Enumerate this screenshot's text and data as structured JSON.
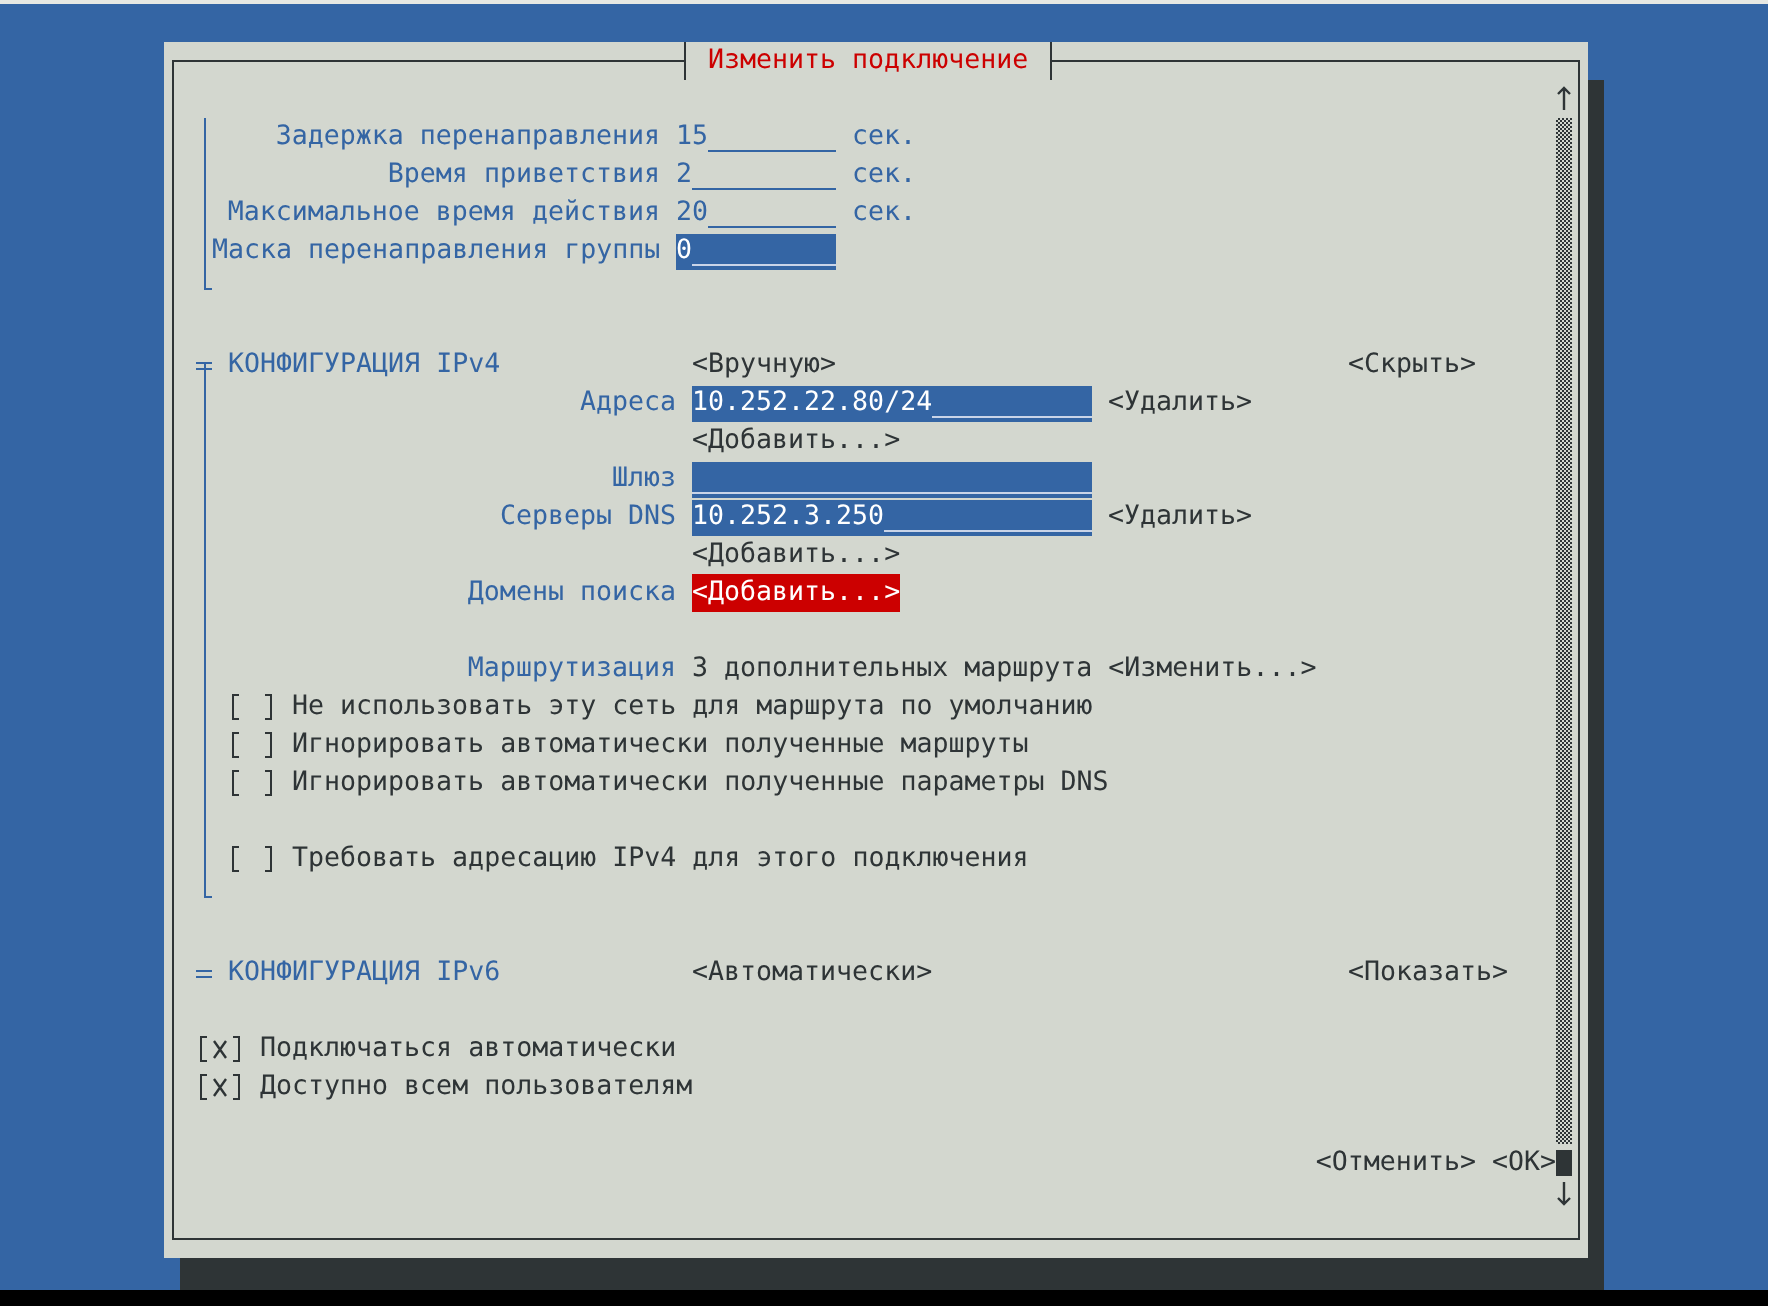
{
  "dialog": {
    "title": "Изменить подключение"
  },
  "bridge_settings": [
    {
      "label": "Задержка перенаправления",
      "value": "15",
      "unit": "сек.",
      "disabled": true
    },
    {
      "label": "Время приветствия",
      "value": "2",
      "unit": "сек.",
      "disabled": true
    },
    {
      "label": "Максимальное время действия",
      "value": "20",
      "unit": "сек.",
      "disabled": true
    },
    {
      "label": "Маска перенаправления группы",
      "value": "0",
      "disabled": false
    }
  ],
  "ipv4": {
    "title": "КОНФИГУРАЦИЯ IPv4",
    "expanded": true,
    "mode": "<Вручную>",
    "toggle": "<Скрыть>",
    "entries": [
      {
        "kind": "field",
        "label": "Адреса",
        "value": "10.252.22.80/24",
        "action": "<Удалить>"
      },
      {
        "kind": "button",
        "action": "<Добавить...>",
        "focused": false
      },
      {
        "kind": "field",
        "label": "Шлюз"
      },
      {
        "kind": "field",
        "label": "Серверы DNS",
        "value": "10.252.3.250",
        "action": "<Удалить>"
      },
      {
        "kind": "button",
        "action": "<Добавить...>",
        "focused": false
      },
      {
        "kind": "button",
        "label": "Домены поиска",
        "action": "<Добавить...>",
        "focused": true
      }
    ],
    "routing": {
      "label": "Маршрутизация",
      "value": "3 дополнительных маршрута",
      "action": "<Изменить...>"
    },
    "options": [
      {
        "label": "Не использовать эту сеть для маршрута по умолчанию",
        "checked": false
      },
      {
        "label": "Игнорировать автоматически полученные маршруты",
        "checked": false
      },
      {
        "label": "Игнорировать автоматически полученные параметры DNS",
        "checked": false
      }
    ],
    "require_option": {
      "label": "Требовать адресацию IPv4 для этого подключения",
      "checked": false
    }
  },
  "ipv6": {
    "title": "КОНФИГУРАЦИЯ IPv6",
    "expanded": false,
    "mode": "<Автоматически>",
    "toggle": "<Показать>"
  },
  "options": [
    {
      "label": "Подключаться автоматически",
      "checked": true
    },
    {
      "label": "Доступно всем пользователям",
      "checked": true
    }
  ],
  "buttons": [
    {
      "label": "<Отменить>"
    },
    {
      "label": "<OK>"
    }
  ]
}
